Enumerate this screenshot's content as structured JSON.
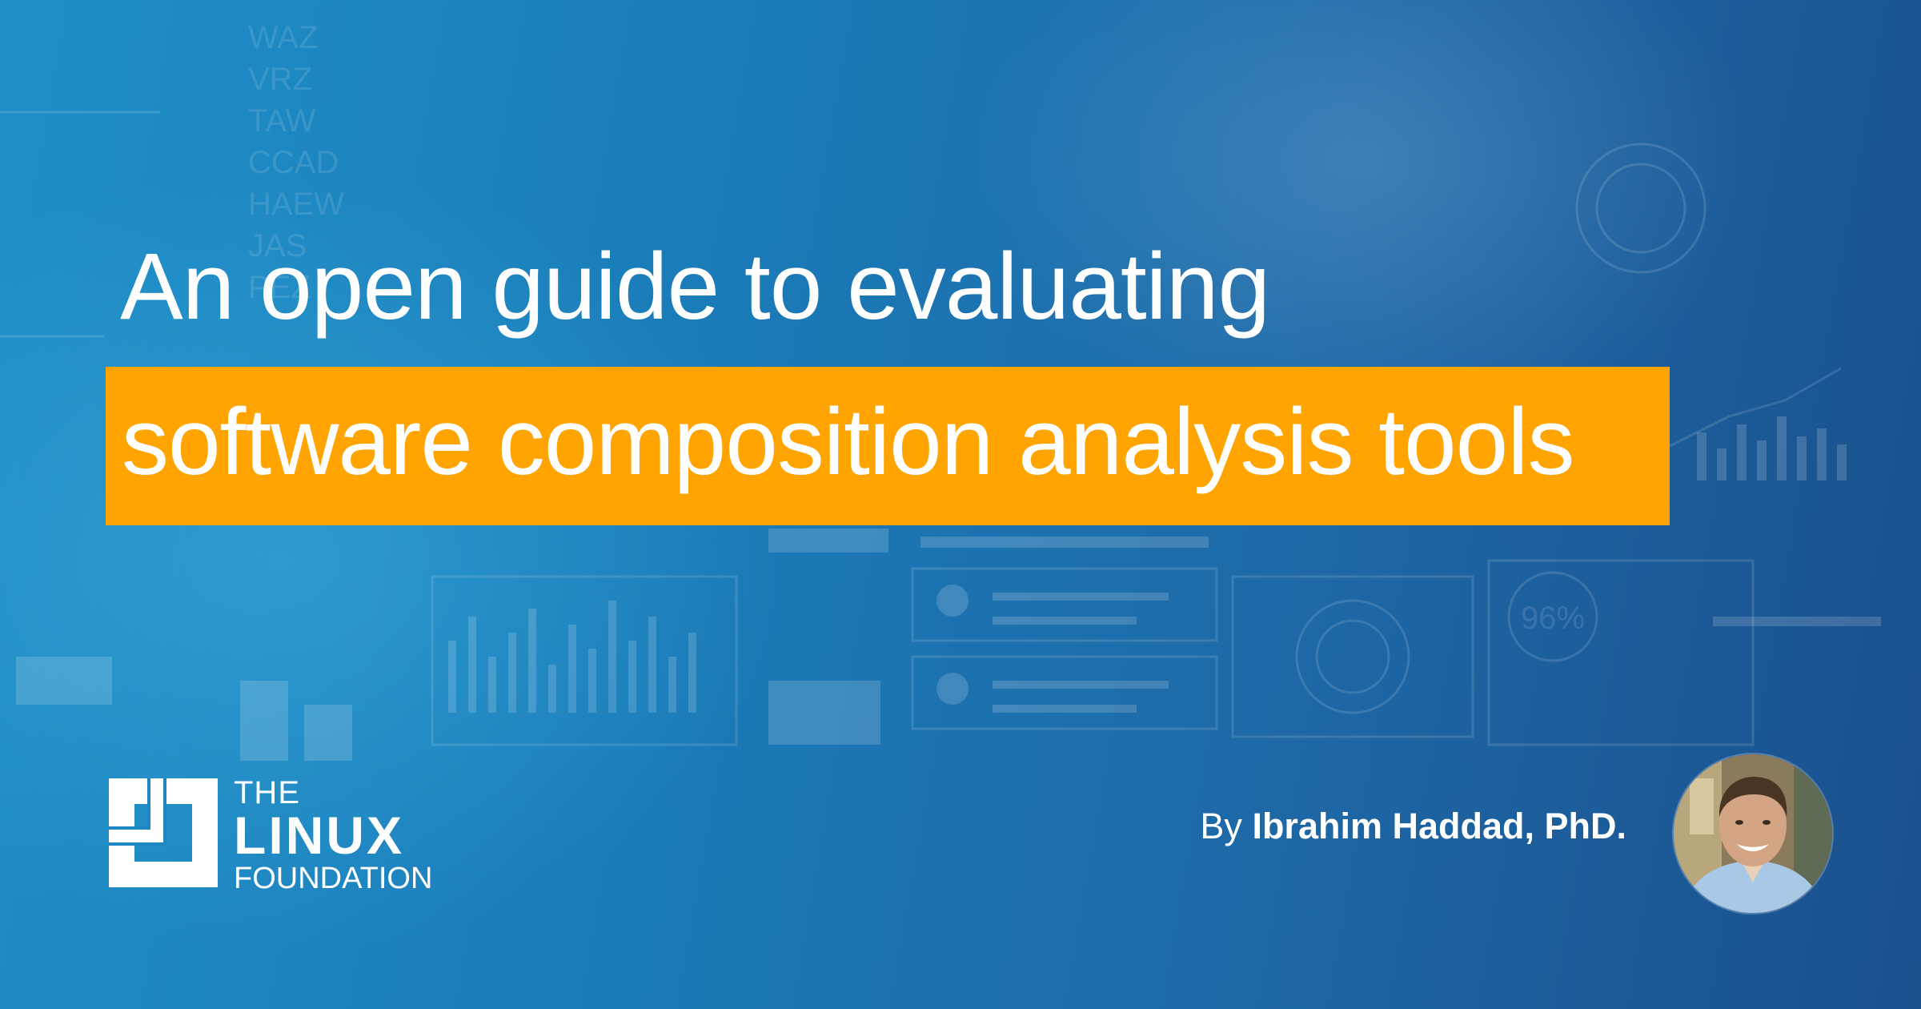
{
  "headline": {
    "line1": "An open guide to evaluating",
    "line2": "software composition analysis tools"
  },
  "byline": {
    "prefix": "By",
    "author": "Ibrahim Haddad, PhD."
  },
  "logo": {
    "the": "THE",
    "linux": "LINUX",
    "foundation": "FOUNDATION"
  },
  "background_text": [
    "WAZ",
    "VRZ",
    "TAW",
    "CCAD",
    "HAEW",
    "JAS",
    "PEZ",
    "96%"
  ],
  "colors": {
    "background_blue": "#1a7cb9",
    "highlight_orange": "#ffa400",
    "text": "#ffffff"
  },
  "icons": {
    "logo_mark": "linux-foundation-logo-mark",
    "author_photo": "author-avatar"
  }
}
